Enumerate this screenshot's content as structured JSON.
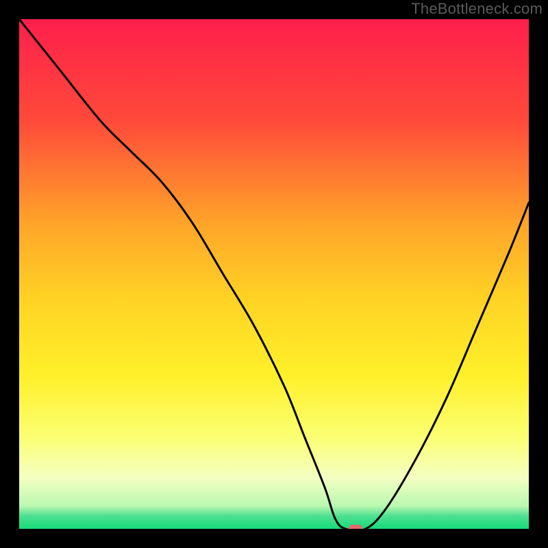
{
  "watermark": "TheBottleneck.com",
  "chart_data": {
    "type": "line",
    "title": "",
    "xlabel": "",
    "ylabel": "",
    "xlim": [
      0,
      100
    ],
    "ylim": [
      0,
      100
    ],
    "grid": false,
    "legend": false,
    "background": {
      "type": "vertical-gradient",
      "stops": [
        {
          "pos": 0.0,
          "color": "#ff1f4b"
        },
        {
          "pos": 0.2,
          "color": "#ff4a3a"
        },
        {
          "pos": 0.4,
          "color": "#ffa429"
        },
        {
          "pos": 0.55,
          "color": "#ffd324"
        },
        {
          "pos": 0.7,
          "color": "#fff02a"
        },
        {
          "pos": 0.82,
          "color": "#fbff72"
        },
        {
          "pos": 0.9,
          "color": "#f4ffc2"
        },
        {
          "pos": 0.955,
          "color": "#baf8b0"
        },
        {
          "pos": 0.975,
          "color": "#4de091"
        },
        {
          "pos": 1.0,
          "color": "#16db7a"
        }
      ]
    },
    "series": [
      {
        "name": "bottleneck-curve",
        "color": "#000000",
        "x": [
          0,
          8,
          16,
          22,
          28,
          34,
          40,
          46,
          52,
          56,
          60,
          62,
          64,
          68,
          72,
          78,
          84,
          90,
          96,
          100
        ],
        "y": [
          100,
          90,
          80,
          74,
          68,
          60,
          50,
          40,
          28,
          18,
          8,
          2,
          0,
          0,
          4,
          14,
          26,
          40,
          54,
          64
        ]
      }
    ],
    "marker": {
      "name": "optimal-point",
      "x": 66,
      "y": 0,
      "color": "#e46a6c",
      "shape": "rounded-rect"
    }
  }
}
